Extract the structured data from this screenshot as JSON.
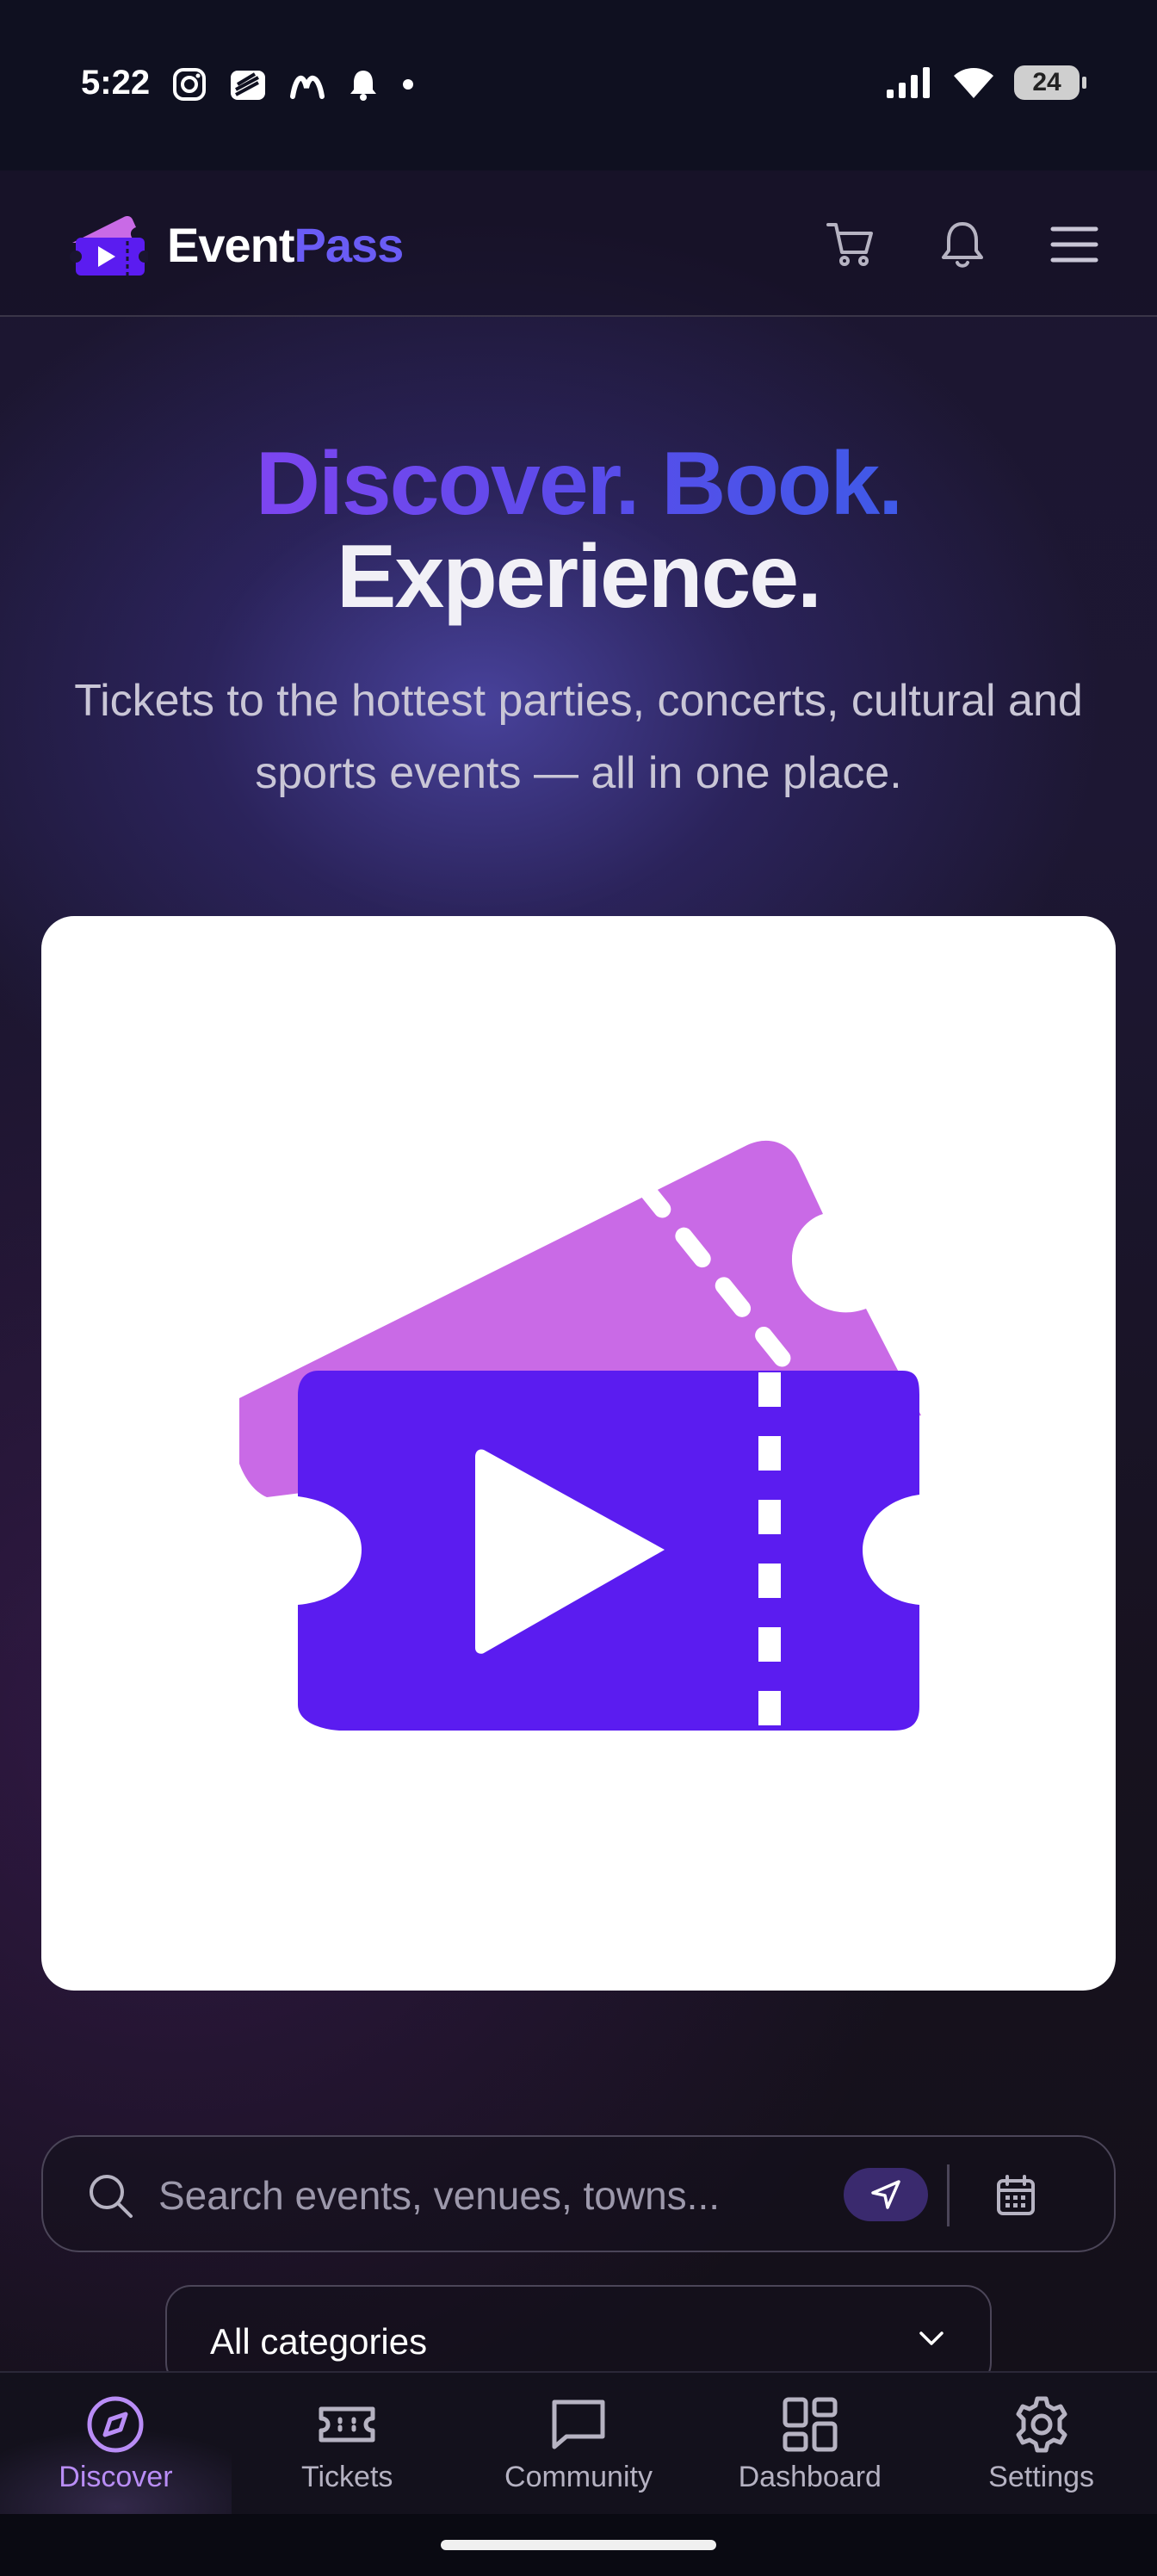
{
  "status_bar": {
    "time": "5:22",
    "battery": "24",
    "left_icons": [
      "instagram-icon",
      "stack-app-icon",
      "threads-m-icon",
      "bell-notification-icon",
      "dot-icon"
    ],
    "right_icons": [
      "signal-icon",
      "wifi-icon",
      "battery-icon"
    ]
  },
  "header": {
    "logo_part1": "Event",
    "logo_part2": "Pass",
    "actions": [
      "cart-icon",
      "bell-icon",
      "menu-icon"
    ]
  },
  "hero": {
    "title_line1": "Discover. Book.",
    "title_line2": "Experience.",
    "subtitle": "Tickets to the hottest parties, concerts, cultural and sports events — all in one place."
  },
  "search": {
    "placeholder": "Search events, venues, towns...",
    "value": ""
  },
  "category": {
    "selected": "All categories"
  },
  "bottom_nav": {
    "items": [
      {
        "label": "Discover",
        "icon": "compass-icon",
        "active": true
      },
      {
        "label": "Tickets",
        "icon": "ticket-icon",
        "active": false
      },
      {
        "label": "Community",
        "icon": "chat-icon",
        "active": false
      },
      {
        "label": "Dashboard",
        "icon": "dashboard-icon",
        "active": false
      },
      {
        "label": "Settings",
        "icon": "gear-icon",
        "active": false
      }
    ]
  },
  "colors": {
    "accent": "#5b1cf0",
    "accent_light": "#c96ae6",
    "nav_active": "#b98df6"
  }
}
